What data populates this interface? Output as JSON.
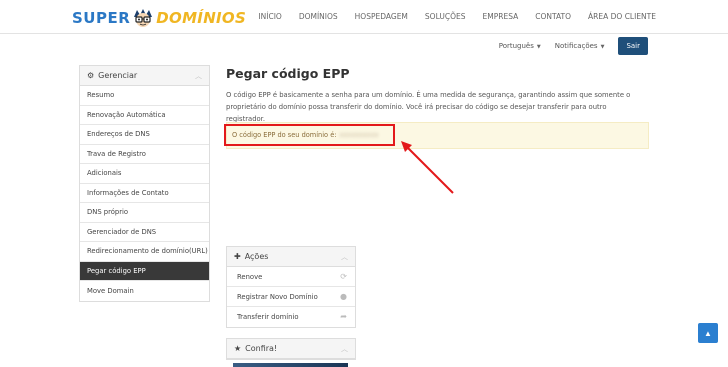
{
  "header": {
    "logo_left": "SUPER",
    "logo_right": "DOMÍNIOS",
    "nav": [
      "INÍCIO",
      "DOMÍNIOS",
      "HOSPEDAGEM",
      "SOLUÇÕES",
      "EMPRESA",
      "CONTATO",
      "ÁREA DO CLIENTE"
    ],
    "brand_blue": "#2b78c5",
    "brand_yellow": "#f0b623"
  },
  "subbar": {
    "language": "Português",
    "notifications": "Notificações",
    "logout": "Sair"
  },
  "sidebar": {
    "title": "Gerenciar",
    "items": [
      "Resumo",
      "Renovação Automática",
      "Endereços de DNS",
      "Trava de Registro",
      "Adicionais",
      "Informações de Contato",
      "DNS próprio",
      "Gerenciador de DNS",
      "Redirecionamento de domínio(URL)",
      "Pegar código EPP",
      "Move Domain"
    ],
    "active_index": 9
  },
  "main": {
    "title": "Pegar código EPP",
    "description": "O código EPP é basicamente a senha para um domínio. É uma medida de segurança, garantindo assim que somente o proprietário do domínio possa transferir do domínio. Você irá precisar do código se desejar transferir para outro registrador.",
    "alert_label": "O código EPP do seu domínio é:",
    "alert_code": "xxxxxxxxxx",
    "highlight_color": "#e3191b"
  },
  "actions_panel": {
    "title": "Ações",
    "items": [
      {
        "label": "Renove",
        "icon": "refresh-icon"
      },
      {
        "label": "Registrar Novo Domínio",
        "icon": "globe-icon"
      },
      {
        "label": "Transferir domínio",
        "icon": "share-icon"
      }
    ]
  },
  "confira_panel": {
    "title": "Confira!"
  }
}
